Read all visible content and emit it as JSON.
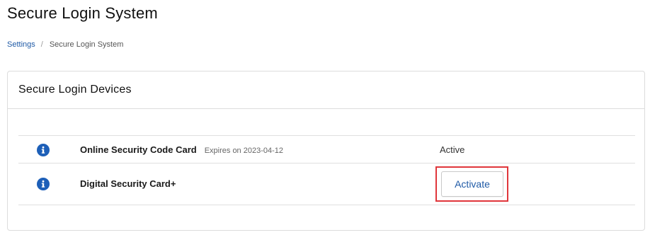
{
  "page": {
    "title": "Secure Login System"
  },
  "breadcrumb": {
    "items": [
      {
        "label": "Settings"
      },
      {
        "label": "Secure Login System"
      }
    ],
    "separator": "/"
  },
  "panel": {
    "title": "Secure Login Devices",
    "devices": [
      {
        "icon": "info-icon",
        "name": "Online Security Code Card",
        "expiry": "Expires on 2023-04-12",
        "status": "Active"
      },
      {
        "icon": "info-icon",
        "name": "Digital Security Card+",
        "action_label": "Activate"
      }
    ]
  },
  "colors": {
    "link": "#1f5aa6",
    "info_icon": "#1d5fb8",
    "highlight": "#e0363b",
    "border": "#dcdcdc"
  }
}
